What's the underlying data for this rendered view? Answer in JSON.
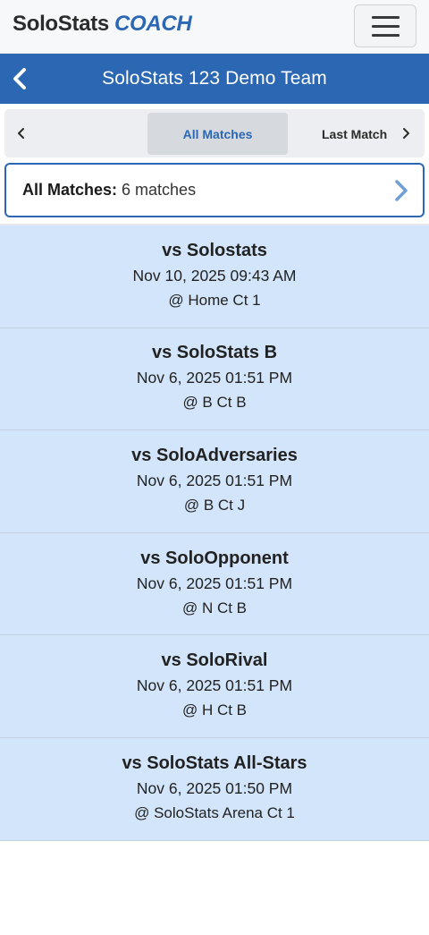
{
  "app": {
    "brand_main": "SoloStats",
    "brand_coach": "COACH"
  },
  "header": {
    "title": "SoloStats 123 Demo Team"
  },
  "tabs": {
    "active": "All Matches",
    "next": "Last Match"
  },
  "filter": {
    "label": "All Matches:",
    "value": "6 matches"
  },
  "colors": {
    "primary": "#2c67b3",
    "row_bg": "#d3e5fa"
  },
  "icons": {
    "back": "chevron-left-icon",
    "menu": "hamburger-menu-icon",
    "prev": "chevron-left-icon",
    "next": "chevron-right-icon",
    "filter": "chevron-right-icon"
  },
  "matches": [
    {
      "opponent": "vs Solostats",
      "datetime": "Nov 10, 2025 09:43 AM",
      "venue": "@ Home Ct 1"
    },
    {
      "opponent": "vs SoloStats B",
      "datetime": "Nov 6, 2025 01:51 PM",
      "venue": "@ B Ct B"
    },
    {
      "opponent": "vs SoloAdversaries",
      "datetime": "Nov 6, 2025 01:51 PM",
      "venue": "@ B Ct J"
    },
    {
      "opponent": "vs SoloOpponent",
      "datetime": "Nov 6, 2025 01:51 PM",
      "venue": "@ N Ct B"
    },
    {
      "opponent": "vs SoloRival",
      "datetime": "Nov 6, 2025 01:51 PM",
      "venue": "@ H Ct B"
    },
    {
      "opponent": "vs SoloStats All-Stars",
      "datetime": "Nov 6, 2025 01:50 PM",
      "venue": "@ SoloStats Arena Ct 1"
    }
  ]
}
